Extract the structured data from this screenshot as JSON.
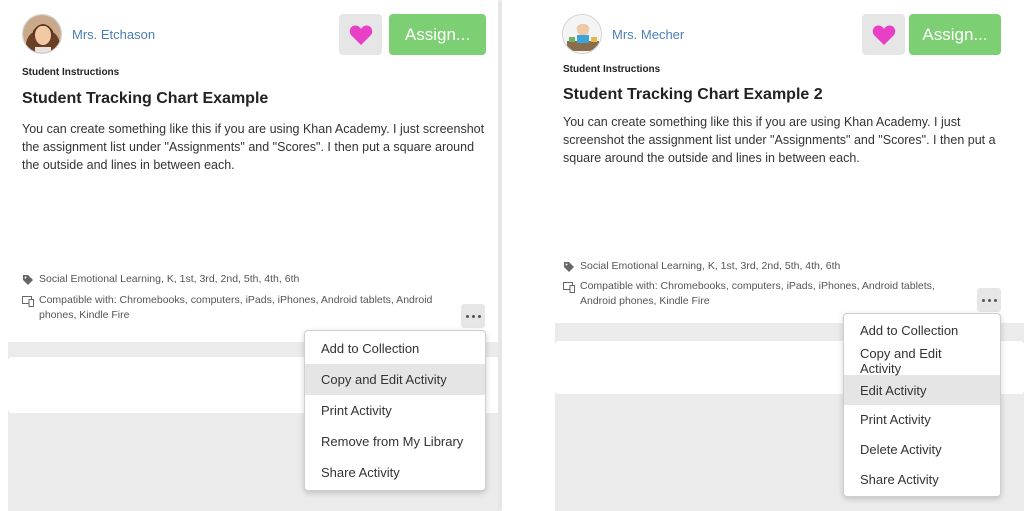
{
  "panels": [
    {
      "author": "Mrs. Etchason",
      "assign_label": "Assign...",
      "section_label": "Student Instructions",
      "title": "Student Tracking Chart Example",
      "description": "You can create something like this if you are using Khan Academy.  I just screenshot the assignment list under \"Assignments\" and \"Scores\".  I then put a square around the outside and lines in between each.",
      "tags": "Social Emotional Learning, K, 1st, 3rd, 2nd, 5th, 4th, 6th",
      "compatible": "Compatible with: Chromebooks, computers, iPads, iPhones, Android tablets, Android phones, Kindle Fire",
      "menu": [
        {
          "label": "Add to Collection",
          "highlighted": false
        },
        {
          "label": "Copy and Edit Activity",
          "highlighted": true
        },
        {
          "label": "Print Activity",
          "highlighted": false
        },
        {
          "label": "Remove from My Library",
          "highlighted": false
        },
        {
          "label": "Share Activity",
          "highlighted": false
        }
      ]
    },
    {
      "author": "Mrs. Mecher",
      "assign_label": "Assign...",
      "section_label": "Student Instructions",
      "title": "Student Tracking Chart Example 2",
      "description": "You can create something like this if you are using Khan Academy.  I just screenshot the assignment list under \"Assignments\" and \"Scores\".  I then put a square around the outside and lines in between each.",
      "tags": "Social Emotional Learning, K, 1st, 3rd, 2nd, 5th, 4th, 6th",
      "compatible": "Compatible with: Chromebooks, computers, iPads, iPhones, Android tablets, Android phones, Kindle Fire",
      "menu": [
        {
          "label": "Add to Collection",
          "highlighted": false
        },
        {
          "label": "Copy and Edit Activity",
          "highlighted": false
        },
        {
          "label": "Edit Activity",
          "highlighted": true
        },
        {
          "label": "Print Activity",
          "highlighted": false
        },
        {
          "label": "Delete Activity",
          "highlighted": false
        },
        {
          "label": "Share Activity",
          "highlighted": false
        }
      ]
    }
  ],
  "colors": {
    "assign_green": "#7dcf73",
    "heart_pink": "#e83fc7",
    "author_link": "#4a7fb5"
  }
}
